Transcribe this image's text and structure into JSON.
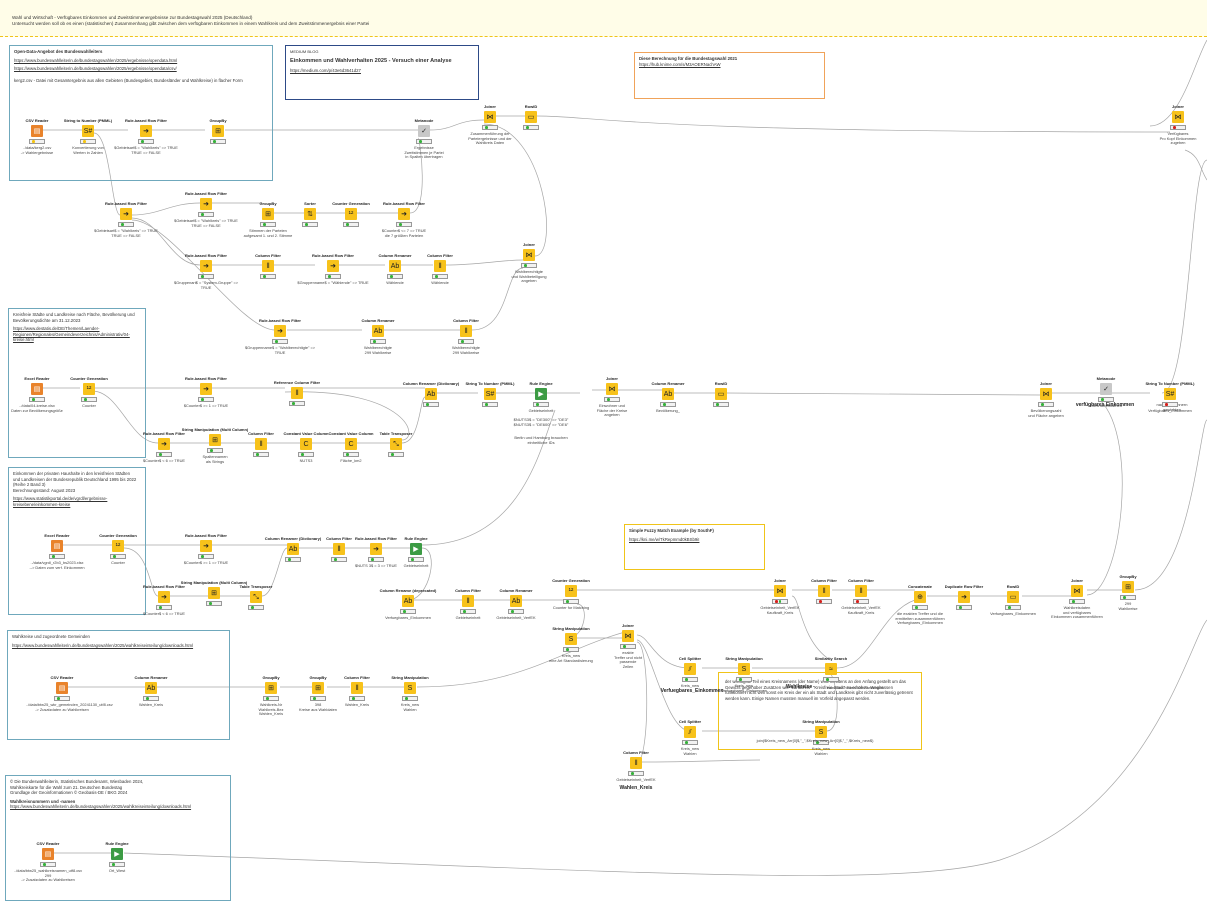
{
  "header": {
    "line1": "Wahl und Wirtschaft - Verfügbares Einkommen und Zweitstimmenergebnisse zur Bundestagswahl 2025 (Deutschland)",
    "line2": "Untersucht werden soll ob es einen (statistischen) Zusammenhang gibt zwischen dem verfügbaren Einkommen in einem Wahlkreis und dem Zweitstimmenergebnis einer Partei"
  },
  "annotations": {
    "opendata": {
      "title": "Open-Data-Angebot des Bundeswahlleiters",
      "link1": "https://www.bundeswahlleiterin.de/bundestagswahlen/2025/ergebnisse/opendata.html",
      "link2": "https://www.bundeswahlleiterin.de/bundestagswahlen/2025/ergebnisse/opendata/csv/",
      "desc": "kerg2.csv - Datei mit Gesamtergebnis aus allen Gebieten (Bundesgebiet, Bundesländer und Wahlkreise) in flacher Form"
    },
    "blog": {
      "kicker": "MEDIUM BLOG",
      "title": "Einkommen und Wahlverhalten 2025 - Versuch einer Analyse",
      "link": "https://medium.com/p/43e6d3641d27"
    },
    "prev": {
      "title": "Diese Berechnung für die Bundestagswahl 2021",
      "link": "https://hub.knime.com/s/M3AOERNachAW"
    },
    "kreise": {
      "p1": "Kreisfreie Städte und Landkreise nach Fläche, Bevölkerung und",
      "p2": "Bevölkerungsdichte am 31.12.2023",
      "l1": "https://www.destatis.de/DE/Themen/Laender-",
      "l2": "Regionen/Regionales/Gemeindeverzeichnis/Administrativ/04-",
      "l3": "kreise.html"
    },
    "einkommen": {
      "p1": "Einkommen der privaten Haushalte in den kreisfreien Städten",
      "p2": "und Landkreisen der Bundesrepublik Deutschland 1995 bis 2022",
      "p3": "(Reihe 2 Band 3)",
      "p4": "Berechnungsstand: August 2023",
      "l1": "https://www.statistikportal.de/de/vgrdl/ergebnisse-",
      "l2": "kreisebene/einkommen-kreise"
    },
    "fuzzy": {
      "title": "Simple Fuzzy Match Example (by SouthF)",
      "link": "https://kni.me/w/TkRepmmd0kBSb9iI"
    },
    "wahlkreise": {
      "title": "Wahlkreise und zugeordnete Gemeinden",
      "link": "https://www.bundeswahlleiterin.de/bundestagswahlen/2025/wahlkreiseinteilung/downloads.html"
    },
    "note": {
      "text": "der wichtigste Teil eines Kreisnamens (der Name) wird meistens an den Anfang gestellt um das Gewicht gegenüber Zusätzen wie \"Landkreis\" \"Kreisfreie Stadt\" zu erhöhen. Wegbassen funktioniert nicht weil sonst ein Kreis der ein als Stadt und Landkreis gibt nicht zuverlässig getrennt werden kann. Einige Namen mussten manuell im Vorfeld angepasst werden."
    },
    "geo": {
      "p1": "© Die Bundeswahlleiterin, Statistisches Bundesamt, Wiesbaden 2024,",
      "p2": "Wahlkreiskarte für die Wahl zum 21. Deutschen Bundestag",
      "p3": "Grundlage der Geoinformationen © Geobasis-DE / BKG 2024",
      "title": "Wahlkreisnummern und -namen",
      "link": "https://www.bundeswahlleiterin.de/bundestagswahlen/2025/wahlkreiseinteilung/downloads.html"
    }
  },
  "nodes": {
    "csv1": {
      "title": "CSV Reader",
      "label": "../data/kerg2.csv\n-> Wahlergebnisse"
    },
    "s2n1": {
      "title": "String to Number (PMML)",
      "label": "Konvertierung von\nWerten in Zahlen"
    },
    "rbf1": {
      "title": "Rule-based Row Filter",
      "label": "$Gebietsart$ = \"Wahlkreis\" => TRUE\nTRUE => FALSE"
    },
    "gb1": {
      "title": "GroupBy",
      "label": ""
    },
    "meta1": {
      "title": "Metanode",
      "label": "Ergebnisse\nZweitstimmen je Partei\nin Spalten übertragen"
    },
    "join1": {
      "title": "Joiner",
      "label": "Zusammenführung der\nParteiergebnisse und der\nWahlkreis Daten"
    },
    "rowid1": {
      "title": "RowID",
      "label": ""
    },
    "join_tr": {
      "title": "Joiner",
      "label": "Verfügbares\nPro Kopf Einkommen\nzugeben"
    },
    "rbf2": {
      "title": "Rule-based Row Filter",
      "label": "$Gebietsart$ = \"Wahlkreis\" => TRUE\nTRUE => FALSE"
    },
    "rbf3": {
      "title": "Rule-based Row Filter",
      "label": "$Gebietsart$ = \"Wahlkreis\" => TRUE\nTRUE => FALSE"
    },
    "gb2": {
      "title": "GroupBy",
      "label": "Stimmen der Parteien\naufgesamt 1. und 2. Stimme"
    },
    "sorter": {
      "title": "Sorter",
      "label": ""
    },
    "cg1": {
      "title": "Counter Generation",
      "label": ""
    },
    "rbf4": {
      "title": "Rule-based Row Filter",
      "label": "$Counter$ <= 7 => TRUE\ndie 7 größten Parteien"
    },
    "rbf5": {
      "title": "Rule-based Row Filter",
      "label": "$Gruppenart$ = \"System-Gruppe\" => TRUE"
    },
    "cf1": {
      "title": "Column Filter",
      "label": ""
    },
    "rbf6": {
      "title": "Rule-based Row Filter",
      "label": "$Gruppenname$ = \"Wählende\" => TRUE"
    },
    "cr1": {
      "title": "Column Renamer",
      "label": "Wählende"
    },
    "cf2": {
      "title": "Column Filter",
      "label": "Wählende"
    },
    "join2": {
      "title": "Joiner",
      "label": "Wahlberechtigte\nund Wahlbeteiligung\nangeben"
    },
    "rbf7": {
      "title": "Rule-based Row Filter",
      "label": "$Gruppenname$ = \"Wahlberechtigte\" => TRUE"
    },
    "cr2": {
      "title": "Column Renamer",
      "label": "Wahlberechtigte\n299 Wahlkreise"
    },
    "cf3": {
      "title": "Column Filter",
      "label": "Wahlberechtigte\n299 Wahlkreise"
    },
    "excel": {
      "title": "Excel Reader",
      "label": "../data/04-kreise.xlsx\nDaten zur Bevölkerungsgröße"
    },
    "cg2": {
      "title": "Counter Generation",
      "label": "Counter"
    },
    "rbf8": {
      "title": "Rule-based Row Filter",
      "label": "$Counter$ >= 1 => TRUE"
    },
    "rbf9": {
      "title": "Rule-based Row Filter",
      "label": "$Counter$ < 6 => TRUE"
    },
    "smm1": {
      "title": "String Manipulation (Multi Column)",
      "label": "Spaltennamen\nals Strings"
    },
    "cf4": {
      "title": "Column Filter",
      "label": ""
    },
    "cvc": {
      "title": "Constant Value Column",
      "label": "NUTS3"
    },
    "cvc2": {
      "title": "Constant Value Column",
      "label": "Fläche_km2"
    },
    "tt1": {
      "title": "Table Transposer",
      "label": ""
    },
    "rcf": {
      "title": "Reference Column Filter",
      "label": ""
    },
    "crd1": {
      "title": "Column Renamer (Dictionary)",
      "label": ""
    },
    "s2n2": {
      "title": "String To Number (PMML)",
      "label": ""
    },
    "rule1": {
      "title": "Rule Engine",
      "label": "Gebietseinheit"
    },
    "rule1note": {
      "title": "",
      "label": "$NUTS3$ = \"DE300\" => \"DE3\"\n$NUTS3$ = \"DE600\" => \"DE6\""
    },
    "rule1note2": {
      "title": "",
      "label": "Berlin und Hamburg brauchen\neinheitliche IDs"
    },
    "join3": {
      "title": "Joiner",
      "label": "Einwohner und\nFläche der Kreise\nangeben"
    },
    "cr3": {
      "title": "Column Renamer",
      "label": "Bevölkerung_"
    },
    "rowid2": {
      "title": "RowID",
      "label": ""
    },
    "join4": {
      "title": "Joiner",
      "label": "Bevölkerungszahl\nund Fläche angeben"
    },
    "meta2": {
      "title": "Metanode",
      "label": "Durchschnittliches"
    },
    "meta2big": {
      "title": "",
      "label": "verfügbares Einkommen"
    },
    "meta2tail": {
      "title": "",
      "label": "nach Einwohnern\ngewichten"
    },
    "s2n3": {
      "title": "String To Number (PMML)",
      "label": "Verfügbares_Einkommen"
    },
    "excel2": {
      "title": "Excel Reader",
      "label": "../data/vgrdl_r2b3_bs2023.xlsx\n--> Daten zum verf. Einkommen"
    },
    "cg3": {
      "title": "Counter Generation",
      "label": "Counter"
    },
    "rbf10": {
      "title": "Rule-based Row Filter",
      "label": "$Counter$ >= 1 => TRUE"
    },
    "rbf11": {
      "title": "Rule-based Row Filter",
      "label": "$Counter$ < 6 => TRUE"
    },
    "smm2": {
      "title": "String Manipulation (Multi Column)",
      "label": ""
    },
    "tt2": {
      "title": "Table Transposer",
      "label": ""
    },
    "crd2": {
      "title": "Column Renamer (Dictionary)",
      "label": ""
    },
    "cf5": {
      "title": "Column Filter",
      "label": ""
    },
    "rbf12": {
      "title": "Rule-based Row Filter",
      "label": "$NUTS 3$ = 3 => TRUE"
    },
    "rule2": {
      "title": "Rule Engine",
      "label": "Gebietseinheit"
    },
    "crdep": {
      "title": "Column Rename (deprecated)",
      "label": "Verfuegbares_Einkommen"
    },
    "cf6": {
      "title": "Column Filter",
      "label": "Gebietseinheit"
    },
    "cr4": {
      "title": "Column Renamer",
      "label": "Gebietseinheit_VerfEK"
    },
    "cg4": {
      "title": "Counter Generation",
      "label": "Counter for Matching"
    },
    "sm1": {
      "title": "String Manipulation",
      "label": "Kreis_new\neine Art Standardisierung"
    },
    "join5": {
      "title": "Joiner",
      "label": "exakte\nTreffer und nicht\npassende\nZeilen"
    },
    "cs1": {
      "title": "Cell Splitter",
      "label": "Kreis_new"
    },
    "cs1big": {
      "title": "",
      "label": "Verfuegbares_Einkommen"
    },
    "sm2": {
      "title": "String Manipulation",
      "label": "Kreis_new\nVerfuegbares_Einkommen"
    },
    "sim": {
      "title": "Similarity Search",
      "label": ""
    },
    "simnote": {
      "title": "",
      "label": "Wahlkreise"
    },
    "simnote2": {
      "title": "",
      "label": "zuordnen mittels der Ähnlichkeit"
    },
    "join6": {
      "title": "Joiner",
      "label": "Gebietseinheit_VerfEK\nKaufkraft_Kreis"
    },
    "cf7": {
      "title": "Column Filter",
      "label": ""
    },
    "cf8": {
      "title": "Column Filter",
      "label": "Gebietseinheit_VerfEK\nKaufkraft_Kreis"
    },
    "concat": {
      "title": "Concatenate",
      "label": "die exakten Treffer und die\nermittelten zusammenführen\nVerfuegbares_Einkommen"
    },
    "drf": {
      "title": "Duplicate Row Filter",
      "label": ""
    },
    "rowid3": {
      "title": "RowID",
      "label": "Verfuegbares_Einkommen"
    },
    "join7": {
      "title": "Joiner",
      "label": "Wahlkreisdaten\nund verfügbares\nEinkommen zusammenführen"
    },
    "gb3": {
      "title": "GroupBy",
      "label": "299\nWahlkreise"
    },
    "cs2": {
      "title": "Cell Splitter",
      "label": "Kreis_new\nWahlen"
    },
    "sm3": {
      "title": "String Manipulation",
      "label": "Kreis_new\nWahlen"
    },
    "sm3note": {
      "title": "",
      "label": "join($Kreis_new_Arr[0]$,\"_\",$Kreis_new_Arr[0]$,\"_\",$Kreis_new$)"
    },
    "cf9": {
      "title": "Column Filter",
      "label": "Gebietseinheit_VerfEK"
    },
    "cf9big": {
      "title": "",
      "label": "Wahlen_Kreis"
    },
    "csv2": {
      "title": "CSV Reader",
      "label": "../data/btw25_wkr_gemeinden_20241130_utf8.csv\n-> Zusatzdaten zu Wahlkreisen"
    },
    "cr5": {
      "title": "Column Renamer",
      "label": "Wahlen_Kreis"
    },
    "gb4": {
      "title": "GroupBy",
      "label": "Wahlkreis-Nr\nWahlkreis-Bez\nWahlen_Kreis"
    },
    "gb5": {
      "title": "GroupBy",
      "label": "398\nKreise aus Wahldaten"
    },
    "cf10": {
      "title": "Column Filter",
      "label": "Wahlen_Kreis"
    },
    "sm4": {
      "title": "String Manipulation",
      "label": "Kreis_new\nWahlen"
    },
    "csv3": {
      "title": "CSV Reader",
      "label": "../data/btw25_wahlkreisnamen_utf8.csv\n299\n-> Zusatzdaten zu Wahlkreisen"
    },
    "rule3": {
      "title": "Rule Engine",
      "label": "Ort_West"
    }
  }
}
